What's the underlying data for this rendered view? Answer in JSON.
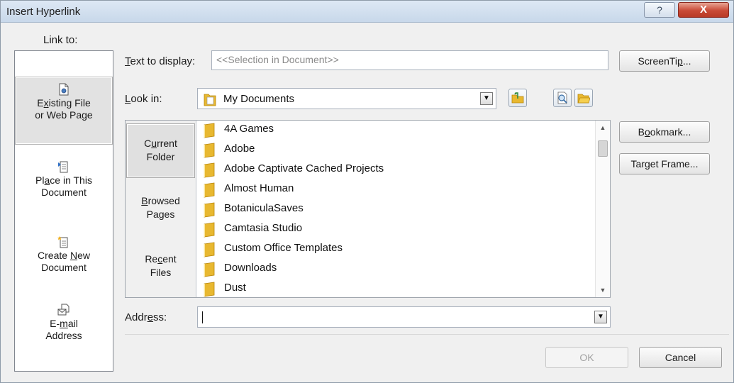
{
  "window": {
    "title": "Insert Hyperlink",
    "help_label": "?",
    "close_label": "X"
  },
  "link_to": {
    "label": "Link to:",
    "items": [
      {
        "label_pre": "E",
        "label_u": "x",
        "label_post": "isting File",
        "label_line2": "or Web Page",
        "icon": "existing-file-icon",
        "selected": true
      },
      {
        "label_pre": "Pl",
        "label_u": "a",
        "label_post": "ce in This",
        "label_line2": "Document",
        "icon": "place-in-document-icon",
        "selected": false
      },
      {
        "label_pre": "Create ",
        "label_u": "N",
        "label_post": "ew",
        "label_line2": "Document",
        "icon": "create-new-document-icon",
        "selected": false
      },
      {
        "label_pre": "E-",
        "label_u": "m",
        "label_post": "ail",
        "label_line2": "Address",
        "icon": "email-address-icon",
        "selected": false
      }
    ]
  },
  "text_to_display": {
    "label_u": "T",
    "label_rest": "ext to display:",
    "value": "<<Selection in Document>>"
  },
  "look_in": {
    "label_u": "L",
    "label_rest": "ook in:",
    "value": "My Documents"
  },
  "browse_nav": {
    "current": {
      "line1_pre": "C",
      "line1_u": "u",
      "line1_post": "rrent",
      "line2": "Folder"
    },
    "browsed": {
      "line1_pre": "",
      "line1_u": "B",
      "line1_post": "rowsed",
      "line2": "Pages"
    },
    "recent": {
      "line1_pre": "Re",
      "line1_u": "c",
      "line1_post": "ent",
      "line2": "Files"
    }
  },
  "files": [
    "4A Games",
    "Adobe",
    "Adobe Captivate Cached Projects",
    "Almost Human",
    "BotaniculaSaves",
    "Camtasia Studio",
    "Custom Office Templates",
    "Downloads",
    "Dust"
  ],
  "address": {
    "label_pre": "Addr",
    "label_u": "e",
    "label_post": "ss:",
    "value": ""
  },
  "buttons": {
    "screentip_pre": "ScreenTi",
    "screentip_u": "p",
    "screentip_post": "...",
    "bookmark_pre": "B",
    "bookmark_u": "o",
    "bookmark_post": "okmark...",
    "target_pre": "Tar",
    "target_u": "g",
    "target_post": "et Frame...",
    "ok": "OK",
    "cancel": "Cancel"
  },
  "colors": {
    "folder": "#e8b830",
    "close_button": "#c94a36",
    "selection": "#e0e0e0"
  }
}
